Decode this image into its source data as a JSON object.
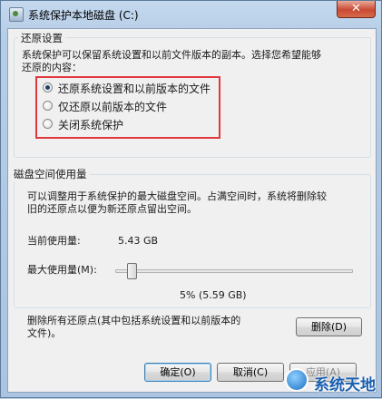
{
  "window": {
    "title": "系统保护本地磁盘 (C:)",
    "close_label": "✕"
  },
  "restore_settings": {
    "group_title": "还原设置",
    "description": [
      "系统保护可以保留系统设置和以前文件版本的副本。选择您希望能够",
      "还原的内容："
    ],
    "options": [
      {
        "label": "还原系统设置和以前版本的文件",
        "checked": true
      },
      {
        "label": "仅还原以前版本的文件",
        "checked": false
      },
      {
        "label": "关闭系统保护",
        "checked": false
      }
    ]
  },
  "disk_usage": {
    "group_title": "磁盘空间使用量",
    "description": [
      "可以调整用于系统保护的最大磁盘空间。占满空间时，系统将删除较",
      "旧的还原点以便为新还原点留出空间。"
    ],
    "current_usage_label": "当前使用量:",
    "current_usage_value": "5.43 GB",
    "max_usage_label": "最大使用量(M):",
    "max_usage_percent": 5,
    "max_usage_text": "5% (5.59 GB)"
  },
  "delete_section": {
    "description": [
      "删除所有还原点(其中包括系统设置和以前版本的",
      "文件)。"
    ],
    "delete_button": "删除(D)"
  },
  "footer": {
    "ok_button": "确定(O)",
    "cancel_button": "取消(C)",
    "apply_button": "应用(A)"
  },
  "watermark": {
    "text": "系统天地"
  },
  "colors": {
    "highlight_border": "#e0383e",
    "close_button": "#c94a33"
  }
}
